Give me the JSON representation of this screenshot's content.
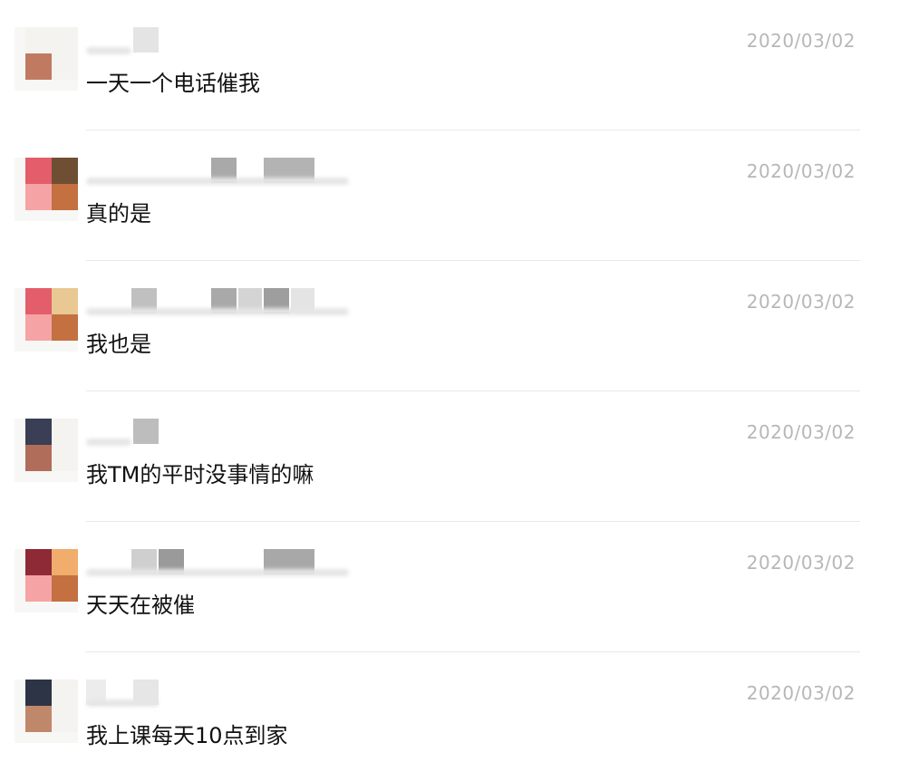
{
  "comments": [
    {
      "message": "一天一个电话催我",
      "timestamp": "2020/03/02",
      "avatar_colors": [
        "#f4f3ef",
        "#f4f3ef",
        "#c07a62",
        "#f4f3ef"
      ]
    },
    {
      "message": "真的是",
      "timestamp": "2020/03/02",
      "avatar_colors": [
        "#e35d6a",
        "#6e4f33",
        "#f6a3a5",
        "#c47040"
      ]
    },
    {
      "message": "我也是",
      "timestamp": "2020/03/02",
      "avatar_colors": [
        "#e35d6a",
        "#e9c893",
        "#f6a3a5",
        "#c47040"
      ]
    },
    {
      "message": "我TM的平时没事情的嘛",
      "timestamp": "2020/03/02",
      "avatar_colors": [
        "#3a3f55",
        "#f4f3ef",
        "#b06e5a",
        "#f4f3ef"
      ]
    },
    {
      "message": "天天在被催",
      "timestamp": "2020/03/02",
      "avatar_colors": [
        "#8e2a35",
        "#f0ad6c",
        "#f6a3a5",
        "#c47040"
      ]
    },
    {
      "message": "我上课每天10点到家",
      "timestamp": "2020/03/02",
      "avatar_colors": [
        "#2c3446",
        "#f4f3ef",
        "#c0886a",
        "#f4f3ef"
      ]
    }
  ]
}
